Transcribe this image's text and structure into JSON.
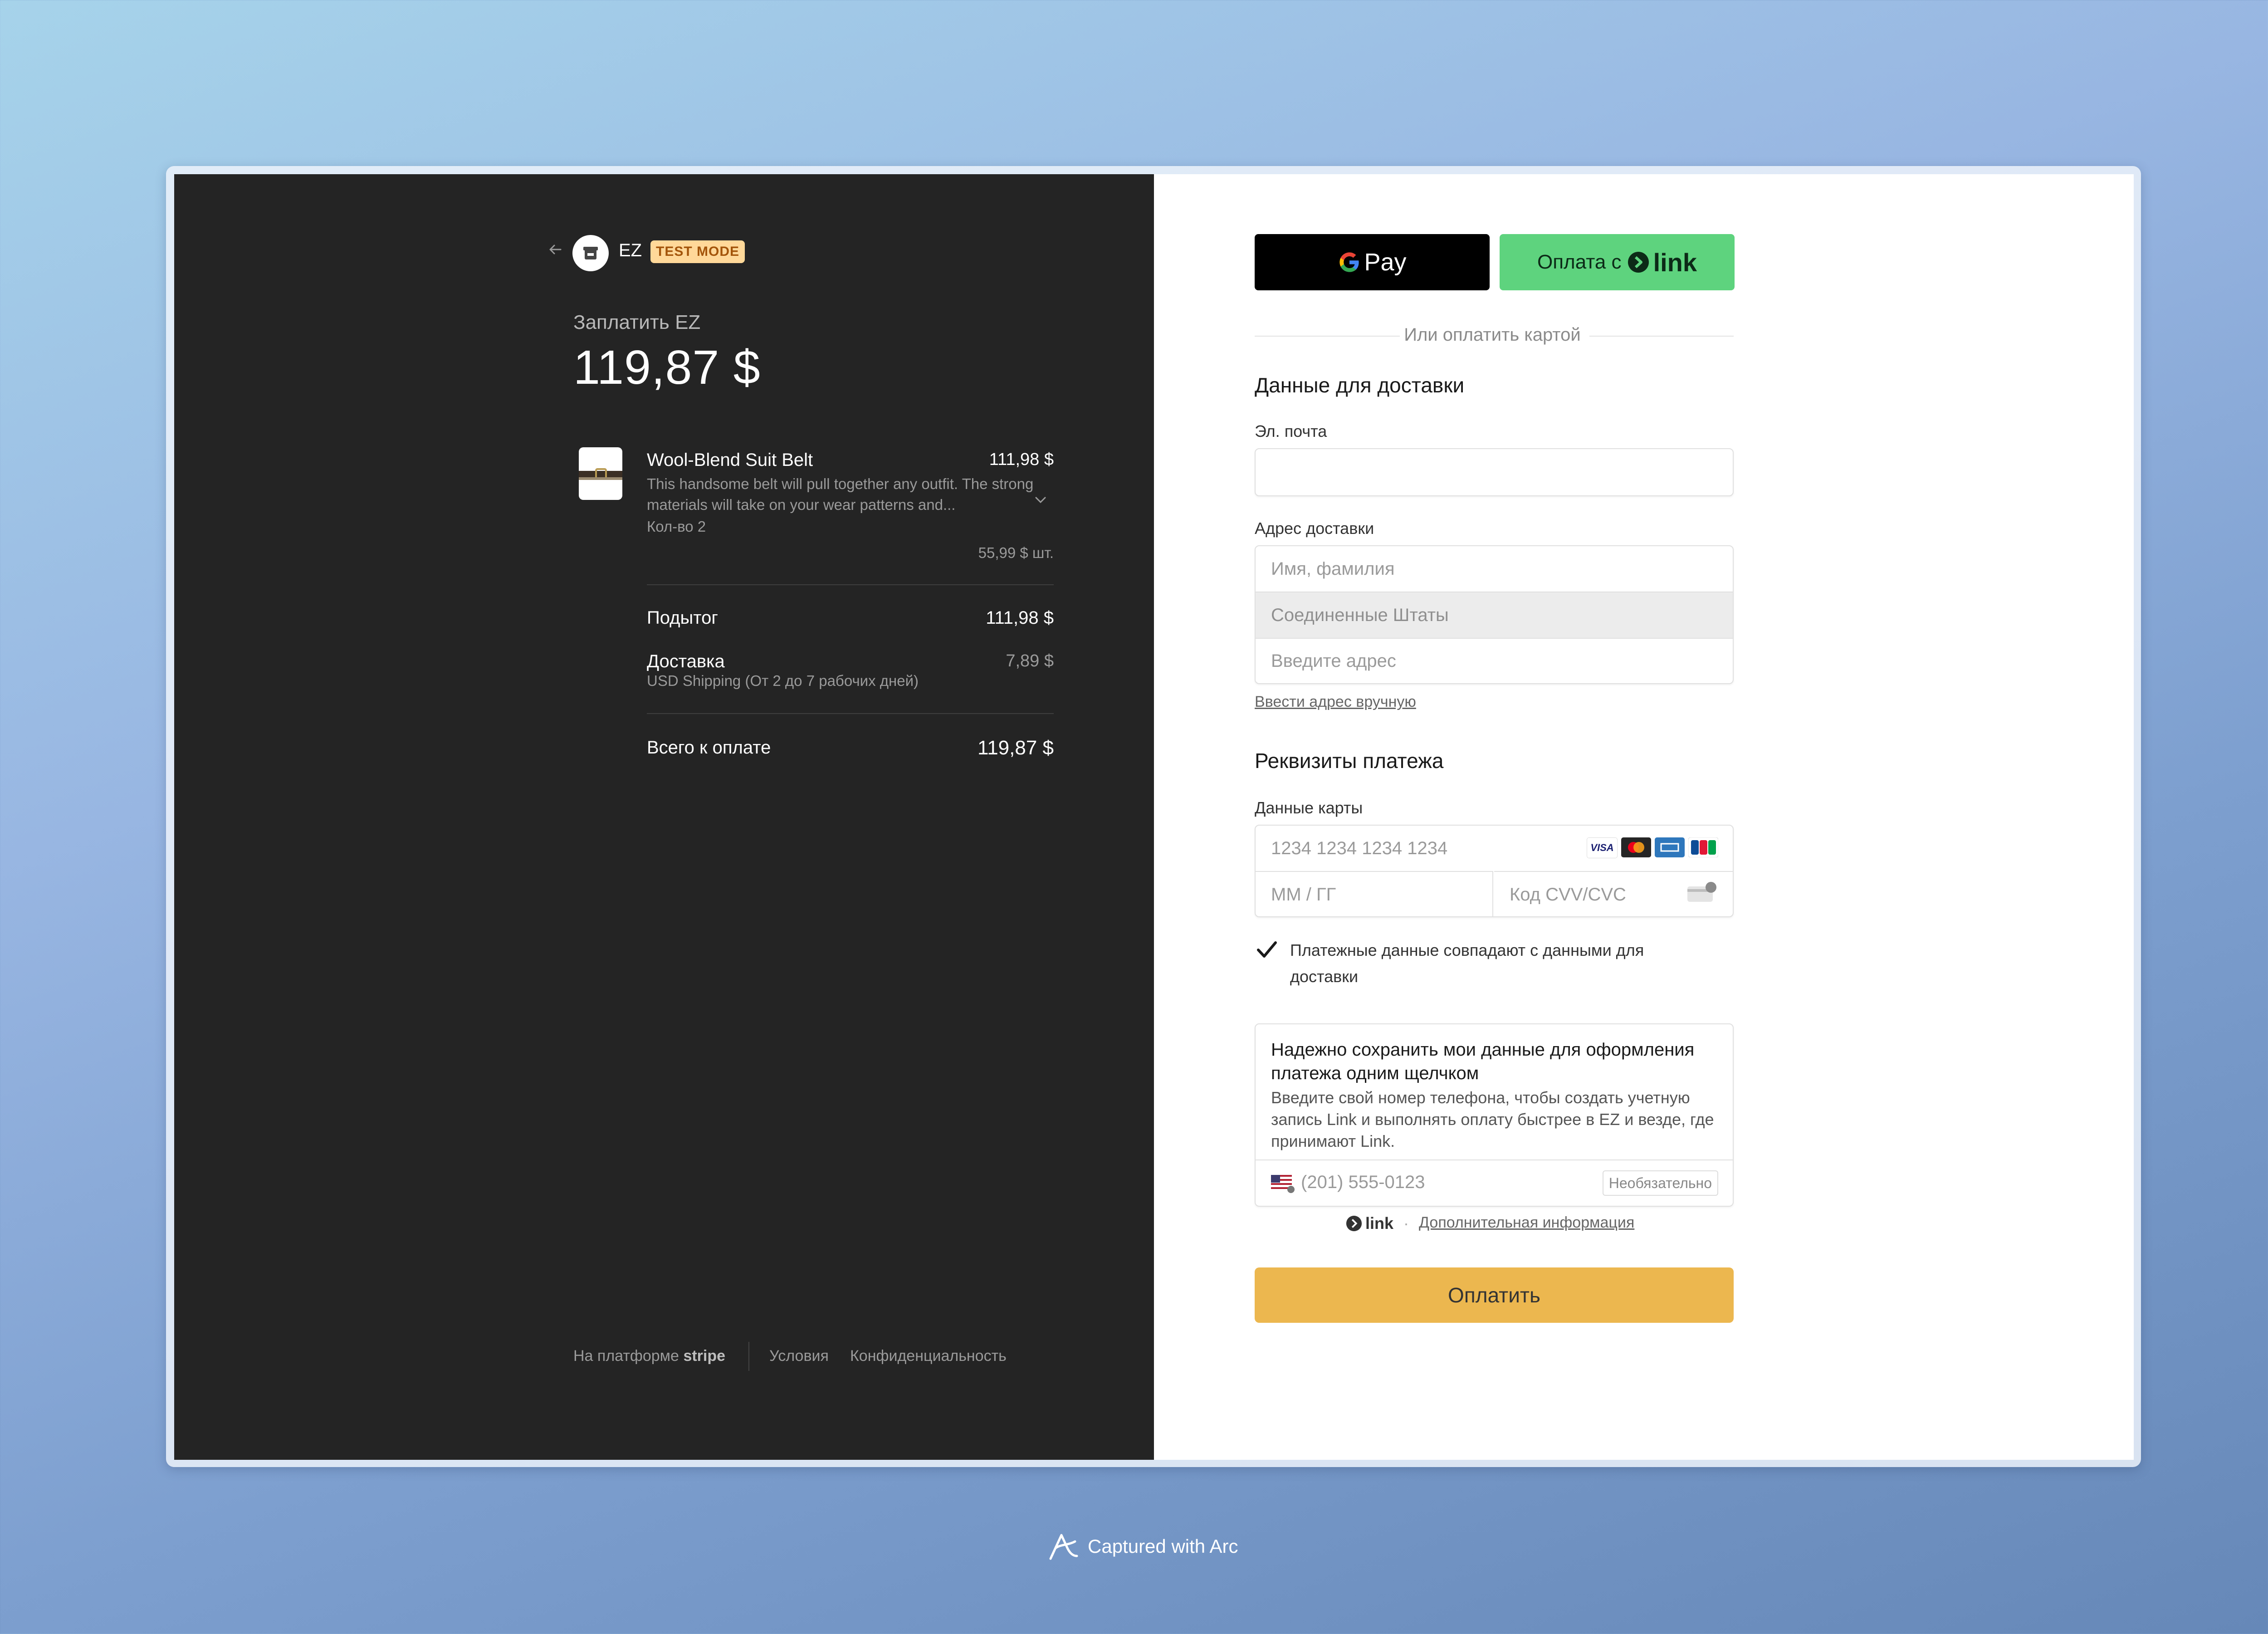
{
  "merchant": {
    "name": "EZ",
    "badge": "TEST MODE"
  },
  "summary": {
    "pay_label": "Заплатить EZ",
    "amount": "119,87 $",
    "item": {
      "name": "Wool-Blend Suit Belt",
      "price": "111,98 $",
      "description": "This handsome belt will pull together any outfit. The strong materials will take on your wear patterns and...",
      "quantity": "Кол-во 2",
      "unit_price": "55,99 $ шт."
    },
    "subtotal_label": "Подытог",
    "subtotal_value": "111,98 $",
    "shipping_label": "Доставка",
    "shipping_detail": "USD Shipping (От 2 до 7 рабочих дней)",
    "shipping_value": "7,89 $",
    "total_label": "Всего к оплате",
    "total_value": "119,87 $"
  },
  "footer": {
    "powered_prefix": "На платформе",
    "powered_brand": "stripe",
    "terms": "Условия",
    "privacy": "Конфиденциальность"
  },
  "payment": {
    "gpay_label": "Pay",
    "link_prefix": "Оплата с",
    "link_word": "link",
    "divider": "Или оплатить картой",
    "shipping_title": "Данные для доставки",
    "email_label": "Эл. почта",
    "email_value": "",
    "address_label": "Адрес доставки",
    "name_placeholder": "Имя, фамилия",
    "country": "Соединенные Штаты",
    "address_placeholder": "Введите адрес",
    "manual_address": "Ввести адрес вручную",
    "payment_title": "Реквизиты платежа",
    "card_label": "Данные карты",
    "card_placeholder": "1234 1234 1234 1234",
    "expiry_placeholder": "ММ / ГГ",
    "cvc_placeholder": "Код CVV/CVC",
    "card_brands": [
      "VISA",
      "mastercard",
      "amex",
      "JCB"
    ],
    "billing_same": "Платежные данные совпадают с данными для доставки",
    "billing_checked": true,
    "save_title": "Надежно сохранить мои данные для оформления платежа одним щелчком",
    "save_desc": "Введите свой номер телефона, чтобы создать учетную запись Link и выполнять оплату быстрее в EZ и везде, где принимают Link.",
    "phone_placeholder": "(201) 555-0123",
    "optional": "Необязательно",
    "link_footer_brand": "link",
    "more_info": "Дополнительная информация",
    "pay_button": "Оплатить"
  },
  "capture": {
    "text": "Captured with Arc"
  },
  "colors": {
    "accent": "#ecb74f",
    "link_green": "#5ed37e",
    "dark_panel": "#242424",
    "test_badge": "#ffd899"
  }
}
